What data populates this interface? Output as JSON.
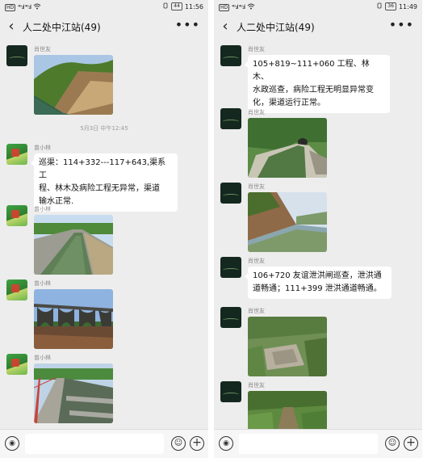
{
  "left": {
    "status": {
      "network": "HD",
      "signal": "⁴ᴳ.ıl ⁴ᴳ.ıl",
      "battery": "44",
      "time": "11:56"
    },
    "title": "人二处中江站(49)",
    "messages": [
      {
        "kind": "image",
        "sender": "肖世友",
        "avatar": "dark",
        "image": "canal-slope-photo"
      },
      {
        "kind": "time",
        "text": "5月3日 中午12:45"
      },
      {
        "kind": "text",
        "sender": "曾小林",
        "avatar": "green",
        "lines": [
          "巡渠：114+332---117+643,渠系工",
          "程、林木及病险工程无异常，渠道",
          "输水正常."
        ]
      },
      {
        "kind": "image",
        "sender": "曾小林",
        "avatar": "green",
        "image": "canal-water-photo"
      },
      {
        "kind": "image",
        "sender": "曾小林",
        "avatar": "green",
        "image": "aqueduct-bridge-photo"
      },
      {
        "kind": "image",
        "sender": "曾小林",
        "avatar": "green",
        "image": "aqueduct-walkway-photo"
      }
    ]
  },
  "right": {
    "status": {
      "network": "HD",
      "signal": "⁴ᴳ.ıl ⁴ᴳ.ıl",
      "battery": "36",
      "time": "11:49"
    },
    "title": "人二处中江站(49)",
    "messages": [
      {
        "kind": "text",
        "sender": "肖世友",
        "avatar": "dark",
        "lines": [
          "105+819~111+060 工程、林木、",
          "水政巡查，病险工程无明显异常变",
          "化，渠道运行正常。"
        ]
      },
      {
        "kind": "image",
        "sender": "肖世友",
        "avatar": "dark",
        "image": "canal-tunnel-photo"
      },
      {
        "kind": "image",
        "sender": "肖世友",
        "avatar": "dark",
        "image": "canal-cliff-photo"
      },
      {
        "kind": "text",
        "sender": "肖世友",
        "avatar": "dark",
        "lines": [
          "106+720 友谊泄洪闸巡查，泄洪通",
          "道畅通；111+399 泄洪通道畅通。"
        ]
      },
      {
        "kind": "image",
        "sender": "肖世友",
        "avatar": "dark",
        "image": "flood-channel-photo"
      },
      {
        "kind": "image",
        "sender": "肖世友",
        "avatar": "dark",
        "image": "overgrown-path-photo"
      }
    ]
  },
  "icons": {
    "back": "‹",
    "more": "•••",
    "voice": "◉",
    "emoji": "☺",
    "plus": "+"
  }
}
